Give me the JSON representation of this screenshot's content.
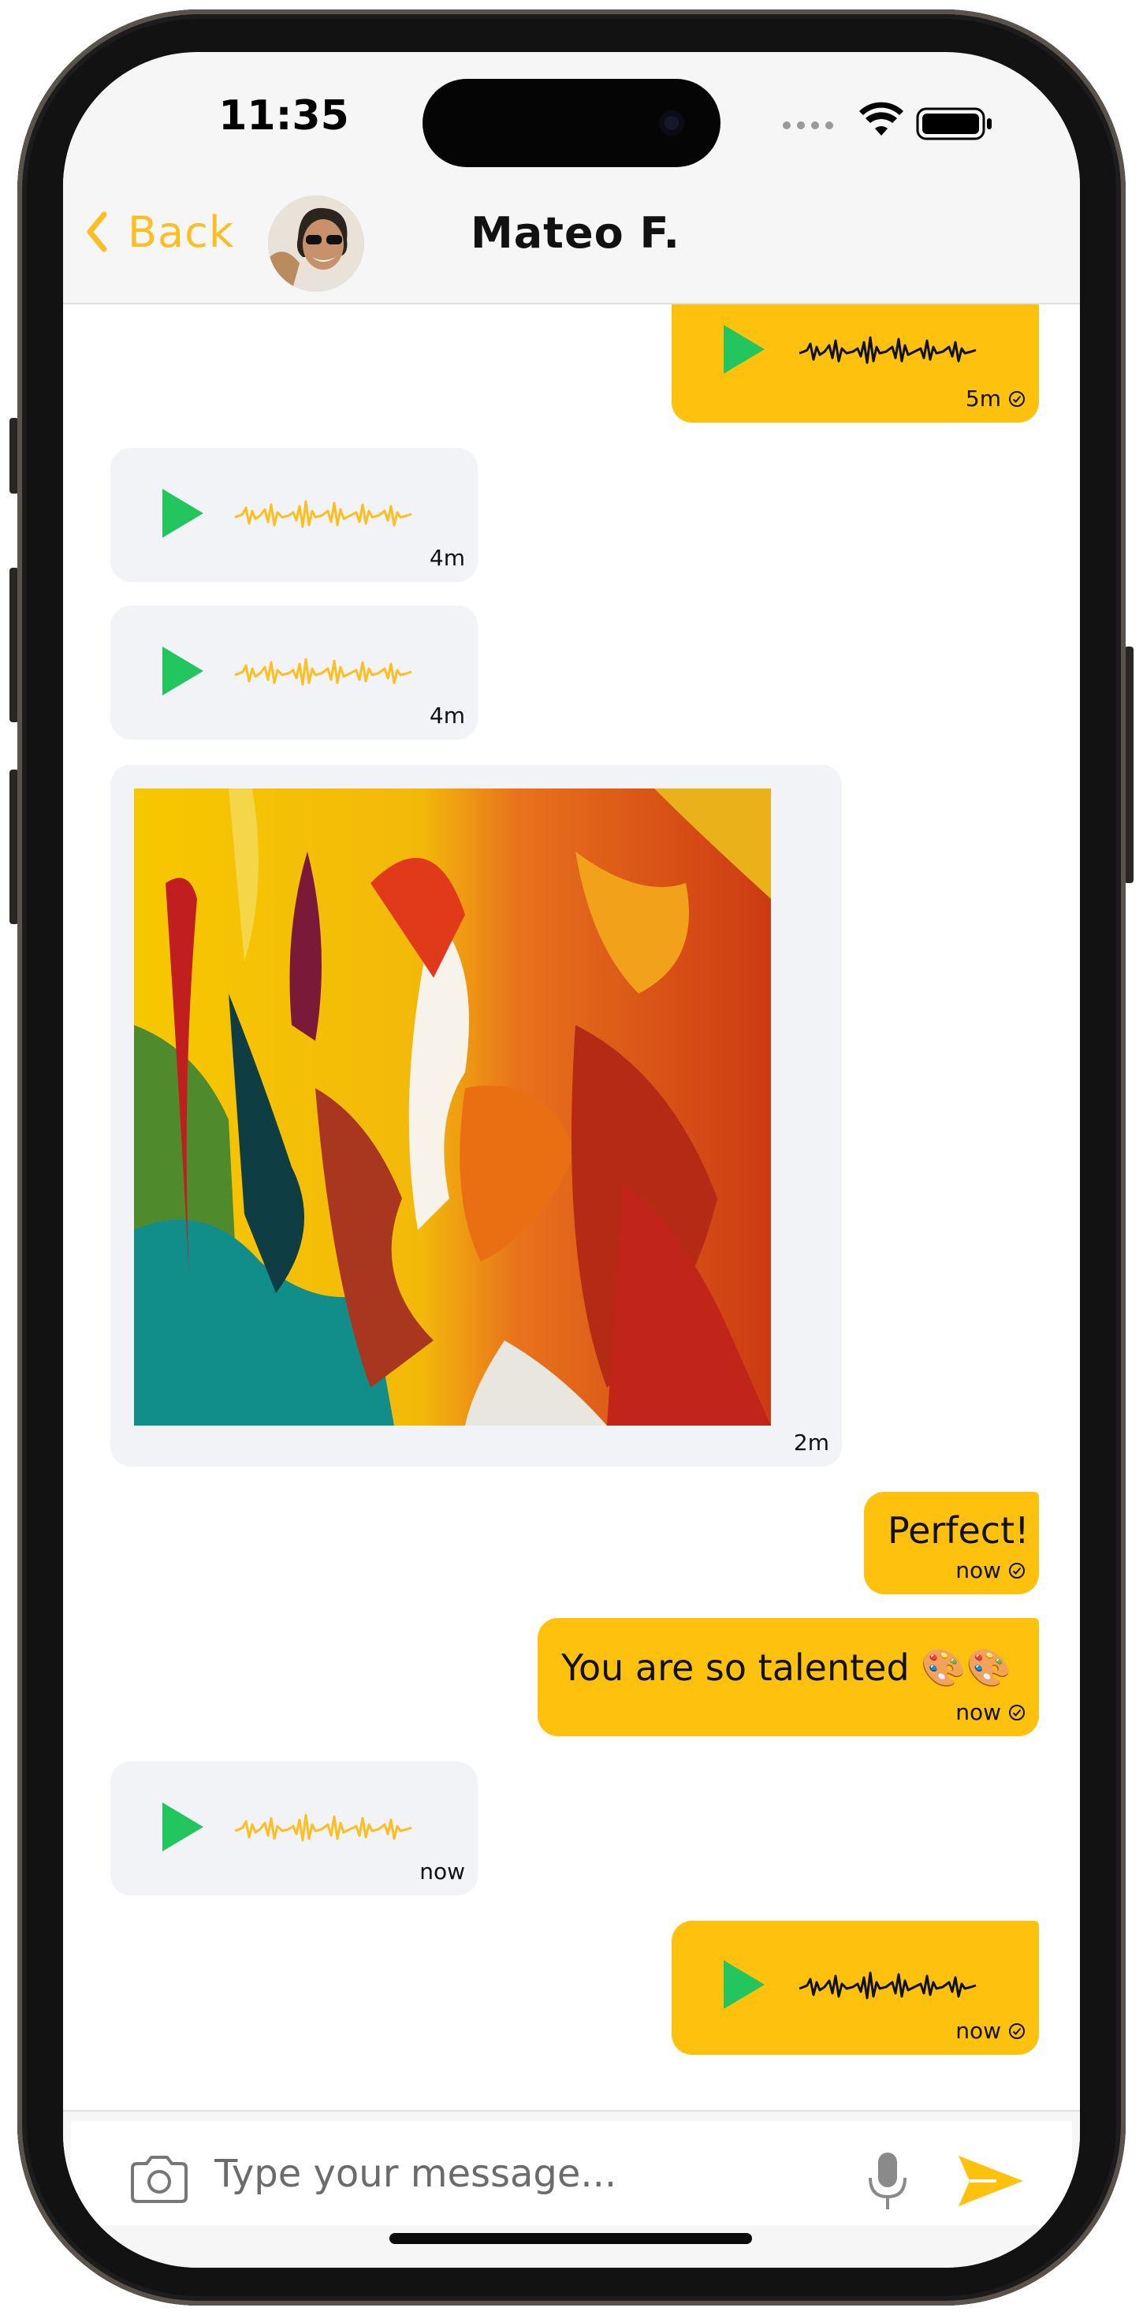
{
  "status_bar": {
    "time": "11:35"
  },
  "header": {
    "back_label": "Back",
    "contact_name": "Mateo F."
  },
  "messages": [
    {
      "id": "m1",
      "type": "voice",
      "direction": "outgoing",
      "time": "5m",
      "read_receipt": true
    },
    {
      "id": "m2",
      "type": "voice",
      "direction": "incoming",
      "time": "4m"
    },
    {
      "id": "m3",
      "type": "voice",
      "direction": "incoming",
      "time": "4m"
    },
    {
      "id": "m4",
      "type": "image",
      "direction": "incoming",
      "time": "2m",
      "image": "abstract-painting"
    },
    {
      "id": "m5",
      "type": "text",
      "direction": "outgoing",
      "text": "Perfect!",
      "time": "now",
      "read_receipt": true
    },
    {
      "id": "m6",
      "type": "text",
      "direction": "outgoing",
      "text": "You are so talented 🎨🎨",
      "time": "now",
      "read_receipt": true
    },
    {
      "id": "m7",
      "type": "voice",
      "direction": "incoming",
      "time": "now"
    },
    {
      "id": "m8",
      "type": "voice",
      "direction": "outgoing",
      "time": "now",
      "read_receipt": true
    }
  ],
  "composer": {
    "placeholder": "Type your message...",
    "value": ""
  },
  "icons": {
    "back": "chevron-left-icon",
    "camera": "camera-icon",
    "mic": "microphone-icon",
    "send": "send-icon",
    "play": "play-icon",
    "waveform": "waveform-icon",
    "read": "check-circle-icon"
  },
  "colors": {
    "accent": "#fec20e",
    "back_text": "#fbbf24",
    "play": "#22c55e",
    "incoming_bubble": "#f2f3f6"
  }
}
